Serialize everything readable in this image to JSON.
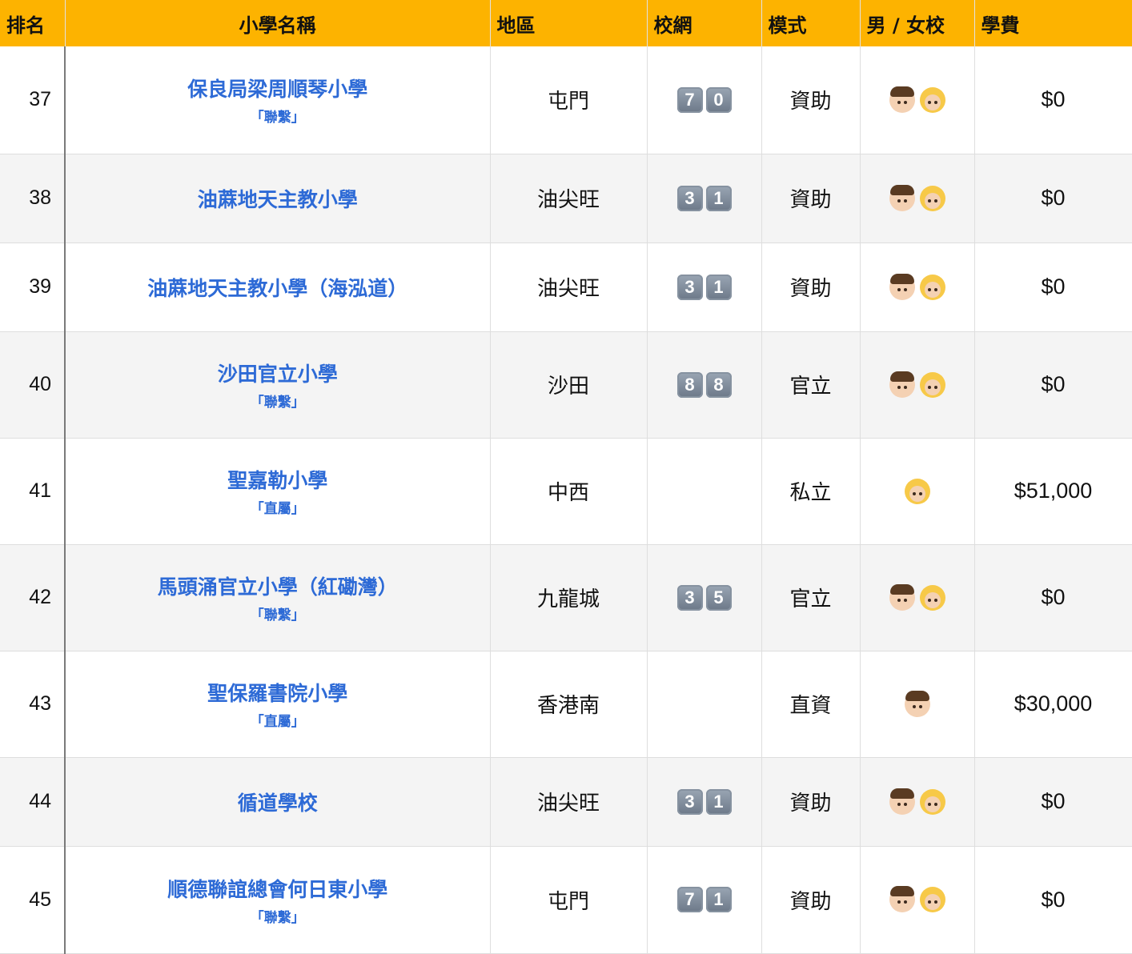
{
  "headers": {
    "rank": "排名",
    "school": "小學名稱",
    "district": "地區",
    "net": "校網",
    "type": "模式",
    "gender": "男 / 女校",
    "fee": "學費"
  },
  "rows": [
    {
      "rank": "37",
      "school": "保良局梁周順琴小學",
      "tag": "「聯繫」",
      "district": "屯門",
      "net": [
        "7",
        "0"
      ],
      "type": "資助",
      "gender": [
        "boy",
        "girl"
      ],
      "fee": "$0"
    },
    {
      "rank": "38",
      "school": "油蔴地天主教小學",
      "tag": "",
      "district": "油尖旺",
      "net": [
        "3",
        "1"
      ],
      "type": "資助",
      "gender": [
        "boy",
        "girl"
      ],
      "fee": "$0"
    },
    {
      "rank": "39",
      "school": "油蔴地天主教小學（海泓道）",
      "tag": "",
      "district": "油尖旺",
      "net": [
        "3",
        "1"
      ],
      "type": "資助",
      "gender": [
        "boy",
        "girl"
      ],
      "fee": "$0"
    },
    {
      "rank": "40",
      "school": "沙田官立小學",
      "tag": "「聯繫」",
      "district": "沙田",
      "net": [
        "8",
        "8"
      ],
      "type": "官立",
      "gender": [
        "boy",
        "girl"
      ],
      "fee": "$0"
    },
    {
      "rank": "41",
      "school": "聖嘉勒小學",
      "tag": "「直屬」",
      "district": "中西",
      "net": [],
      "type": "私立",
      "gender": [
        "girl"
      ],
      "fee": "$51,000"
    },
    {
      "rank": "42",
      "school": "馬頭涌官立小學（紅磡灣）",
      "tag": "「聯繫」",
      "district": "九龍城",
      "net": [
        "3",
        "5"
      ],
      "type": "官立",
      "gender": [
        "boy",
        "girl"
      ],
      "fee": "$0"
    },
    {
      "rank": "43",
      "school": "聖保羅書院小學",
      "tag": "「直屬」",
      "district": "香港南",
      "net": [],
      "type": "直資",
      "gender": [
        "boy"
      ],
      "fee": "$30,000"
    },
    {
      "rank": "44",
      "school": "循道學校",
      "tag": "",
      "district": "油尖旺",
      "net": [
        "3",
        "1"
      ],
      "type": "資助",
      "gender": [
        "boy",
        "girl"
      ],
      "fee": "$0"
    },
    {
      "rank": "45",
      "school": "順德聯誼總會何日東小學",
      "tag": "「聯繫」",
      "district": "屯門",
      "net": [
        "7",
        "1"
      ],
      "type": "資助",
      "gender": [
        "boy",
        "girl"
      ],
      "fee": "$0"
    }
  ]
}
